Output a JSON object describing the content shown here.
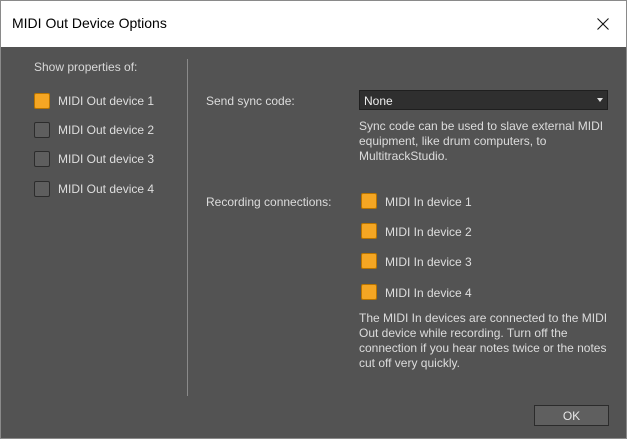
{
  "window": {
    "title": "MIDI Out Device Options",
    "close_icon": "close-icon"
  },
  "left_panel": {
    "heading": "Show properties of:",
    "devices": [
      {
        "label": "MIDI Out device 1",
        "checked": true
      },
      {
        "label": "MIDI Out device 2",
        "checked": false
      },
      {
        "label": "MIDI Out device 3",
        "checked": false
      },
      {
        "label": "MIDI Out device 4",
        "checked": false
      }
    ]
  },
  "sync": {
    "label": "Send sync code:",
    "value": "None",
    "note": "Sync code can be used to slave external MIDI equipment, like drum computers, to MultitrackStudio."
  },
  "recording": {
    "label": "Recording connections:",
    "inputs": [
      {
        "label": "MIDI In device 1",
        "checked": true
      },
      {
        "label": "MIDI In device 2",
        "checked": true
      },
      {
        "label": "MIDI In device 3",
        "checked": true
      },
      {
        "label": "MIDI In device 4",
        "checked": true
      }
    ],
    "note": "The MIDI In devices are connected to the MIDI Out device while recording. Turn off the connection if you hear notes twice or the notes cut off very quickly."
  },
  "buttons": {
    "ok": "OK"
  },
  "colors": {
    "panel": "#535353",
    "checkbox_on": "#f5a623",
    "checkbox_off": "#5e5e5e"
  }
}
